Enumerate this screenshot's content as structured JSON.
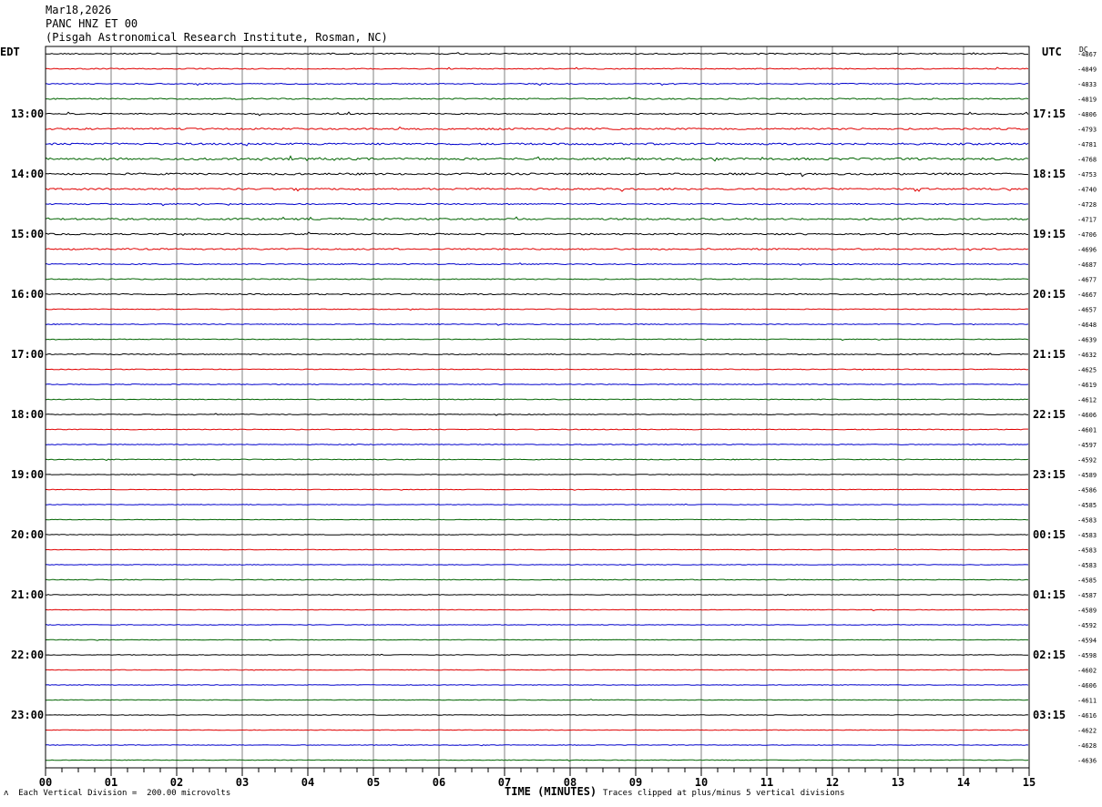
{
  "header": {
    "date": "Mar18,2026",
    "station": "PANC HNZ ET 00",
    "institution": "(Pisgah Astronomical Research Institute, Rosman, NC)"
  },
  "labels": {
    "left_tz": "EDT",
    "right_tz": "UTC",
    "dc": "DC"
  },
  "footer": {
    "left_mark": "ʌ",
    "vertical_division": "Each Vertical Division =  200.00 microvolts",
    "clip_note": "Traces clipped at plus/minus 5 vertical divisions"
  },
  "colors": {
    "trace_cycle": [
      "#000000",
      "#e00000",
      "#0000cc",
      "#006400"
    ],
    "minute_grid": "#808080"
  },
  "chart_data": {
    "type": "line",
    "title": "",
    "xlabel": "TIME (MINUTES)",
    "ylabel": "",
    "x_ticks": [
      "00",
      "01",
      "02",
      "03",
      "04",
      "05",
      "06",
      "07",
      "08",
      "09",
      "10",
      "11",
      "12",
      "13",
      "14",
      "15"
    ],
    "xlim": [
      0,
      15
    ],
    "rows": 48,
    "left_hour_labels": [
      "13:00",
      "14:00",
      "15:00",
      "16:00",
      "17:00",
      "18:00",
      "19:00",
      "20:00",
      "21:00",
      "22:00",
      "23:00"
    ],
    "right_hour_labels": [
      "17:15",
      "18:15",
      "19:15",
      "20:15",
      "21:15",
      "22:15",
      "23:15",
      "00:15",
      "01:15",
      "02:15",
      "03:15"
    ],
    "hour_label_start_row": 4,
    "dc_values": [
      "-4867",
      "-4849",
      "-4833",
      "-4819",
      "-4806",
      "-4793",
      "-4781",
      "-4768",
      "-4753",
      "-4740",
      "-4728",
      "-4717",
      "-4706",
      "-4696",
      "-4687",
      "-4677",
      "-4667",
      "-4657",
      "-4648",
      "-4639",
      "-4632",
      "-4625",
      "-4619",
      "-4612",
      "-4606",
      "-4601",
      "-4597",
      "-4592",
      "-4589",
      "-4586",
      "-4585",
      "-4583",
      "-4583",
      "-4583",
      "-4583",
      "-4585",
      "-4587",
      "-4589",
      "-4592",
      "-4594",
      "-4598",
      "-4602",
      "-4606",
      "-4611",
      "-4616",
      "-4622",
      "-4628",
      "-4636"
    ],
    "activity": [
      0.6,
      0.5,
      0.5,
      0.6,
      0.6,
      0.8,
      0.9,
      1.0,
      0.9,
      0.8,
      0.6,
      0.8,
      0.7,
      0.7,
      0.5,
      0.5,
      0.6,
      0.4,
      0.4,
      0.4,
      0.5,
      0.4,
      0.4,
      0.4,
      0.4,
      0.4,
      0.4,
      0.4,
      0.3,
      0.3,
      0.3,
      0.3,
      0.3,
      0.3,
      0.3,
      0.4,
      0.3,
      0.3,
      0.3,
      0.3,
      0.3,
      0.3,
      0.3,
      0.3,
      0.3,
      0.3,
      0.3,
      0.3
    ]
  }
}
